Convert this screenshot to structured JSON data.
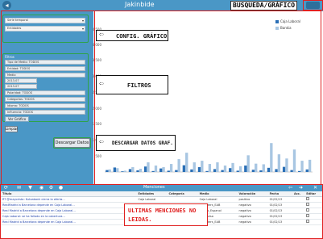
{
  "header": {
    "title": "Jakinbide",
    "annotation": "BUSQUEDA/GRÁFICO"
  },
  "config": {
    "dropdowns": [
      "Serie temporal",
      "Entidades"
    ]
  },
  "filters": {
    "header": "Filtros",
    "fields": [
      "Tipo de Medio: TODOS",
      "Entidad: TODOS",
      "Medio",
      "2013-07",
      "2013-07",
      "Polaridad: TODOS",
      "Categorías: TODOS",
      "Idioma: TODOS",
      "Influencia: TODOS"
    ],
    "button": "Ver Gráfico"
  },
  "actions": {
    "download": "Descargar Datos",
    "clear": "Limpiar"
  },
  "callouts": {
    "config": "CONFIG. GRÁFICO",
    "filters": "FILTROS",
    "download": "DESCARGAR DATOS GRAF.",
    "unread": "ULTIMAS MENCIONES NO LEIDAS."
  },
  "chart_data": {
    "type": "bar",
    "series": [
      {
        "name": "Caja Laboral",
        "color": "#2a6fb6",
        "values": [
          60,
          140,
          20,
          90,
          50,
          170,
          30,
          110,
          40,
          60,
          210,
          80,
          150,
          30,
          90,
          60,
          120,
          40,
          200,
          70,
          50,
          130,
          90,
          160,
          60,
          30,
          80
        ]
      },
      {
        "name": "Bankia",
        "color": "#a8c6e2",
        "values": [
          80,
          120,
          40,
          150,
          100,
          300,
          200,
          150,
          250,
          400,
          600,
          300,
          350,
          250,
          300,
          200,
          280,
          180,
          520,
          260,
          240,
          900,
          550,
          420,
          700,
          350,
          380
        ]
      }
    ],
    "ylim": [
      0,
      4500
    ],
    "yticks": [
      "500",
      "1.000",
      "1.500",
      "2.000",
      "2.500",
      "3.000",
      "3.500",
      "4.000",
      "4.500"
    ]
  },
  "mentions": {
    "title": "Menciones",
    "columns": [
      "Título",
      "Entidades",
      "Categoría",
      "Medio",
      "Valoración",
      "Fecha",
      "Acc.",
      "Editar"
    ],
    "rows": [
      [
        "RT @mayorista: Kutxabank cierra la oferta…",
        "Caja Laboral",
        "",
        "Caja Laboral",
        "positivo",
        "01/02/13",
        "",
        ""
      ],
      [
        "RealMadrid a Barcelona depende en Caja Laboral…",
        "",
        "",
        "Reporters_EAB",
        "negativo",
        "01/02/13",
        "",
        ""
      ],
      [
        "Real Madrid a Barcelona depende en Caja Laboral…",
        "",
        "",
        "Correo_Espanol",
        "negativo",
        "01/02/13",
        "",
        ""
      ],
      [
        "Caja Laboral: se ha fallado en la cobertura…",
        "",
        "",
        "@impulsa",
        "negativo",
        "01/02/13",
        "",
        ""
      ],
      [
        "Real Madrid a Barcelona depende en Caja Laboral…",
        "Caja Laboral",
        "",
        "Reporters_EAB",
        "negativo",
        "01/02/13",
        "",
        ""
      ]
    ]
  }
}
